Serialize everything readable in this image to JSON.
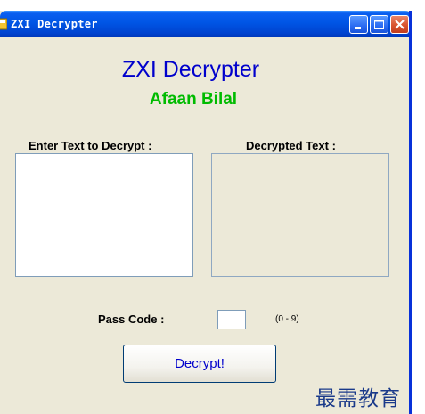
{
  "window": {
    "title": "ZXI Decrypter"
  },
  "app": {
    "title": "ZXI Decrypter",
    "author": "Afaan Bilal"
  },
  "input": {
    "label": "Enter Text to Decrypt :",
    "value": ""
  },
  "output": {
    "label": "Decrypted Text :",
    "value": ""
  },
  "pass_code": {
    "label": "Pass Code :",
    "value": "",
    "range_hint": "(0 - 9)"
  },
  "actions": {
    "decrypt_label": "Decrypt!"
  },
  "watermark": "最需教育",
  "colors": {
    "title_blue": "#0000cc",
    "author_green": "#00bb00",
    "titlebar_blue": "#0055e5",
    "window_bg": "#ece9d8"
  },
  "icons": {
    "app": "app-icon",
    "minimize": "minimize-icon",
    "maximize": "maximize-icon",
    "close": "close-icon"
  }
}
